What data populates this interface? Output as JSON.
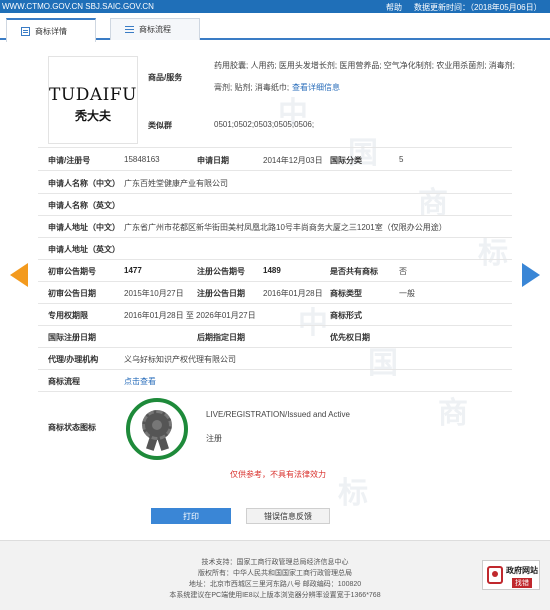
{
  "topbar": {
    "url": "WWW.CTMO.GOV.CN SBJ.SAIC.GOV.CN",
    "help": "帮助",
    "update": "数据更新时间：（2018年05月06日）"
  },
  "tabs": [
    {
      "label": "商标详情"
    },
    {
      "label": "商标流程"
    }
  ],
  "logo": {
    "line1": "TUDAIFU",
    "line2": "秃大夫"
  },
  "watermark_chars": [
    "中",
    "国",
    "商",
    "标"
  ],
  "goods": {
    "label": "商品/服务",
    "line1": "药用胶囊; 人用药; 医用头发增长剂; 医用营养品; 空气净化制剂; 农业用杀菌剂; 消毒剂;",
    "line2": "膏剂; 贴剂; 消毒纸巾;",
    "detail_link": "查看详细信息"
  },
  "similar_group": {
    "label": "类似群",
    "value": "0501;0502;0503;0505;0506;"
  },
  "reg_no": {
    "label": "申请/注册号",
    "value": "15848163"
  },
  "app_date": {
    "label": "申请日期",
    "value": "2014年12月03日"
  },
  "intl_class": {
    "label": "国际分类",
    "value": "5"
  },
  "applicant_cn": {
    "label": "申请人名称（中文）",
    "value": "广东百姓堂健康产业有限公司"
  },
  "applicant_en": {
    "label": "申请人名称（英文）",
    "value": ""
  },
  "address_cn": {
    "label": "申请人地址（中文）",
    "value": "广东省广州市花都区新华街田美村凤凰北路10号丰尚商务大厦之三1201室（仅限办公用途）"
  },
  "address_en": {
    "label": "申请人地址（英文）",
    "value": ""
  },
  "prelim_no": {
    "label": "初审公告期号",
    "value": "1477"
  },
  "reg_pub_no": {
    "label": "注册公告期号",
    "value": "1489"
  },
  "shared": {
    "label": "是否共有商标",
    "value": "否"
  },
  "prelim_date": {
    "label": "初审公告日期",
    "value": "2015年10月27日"
  },
  "reg_pub_date": {
    "label": "注册公告日期",
    "value": "2016年01月28日"
  },
  "tm_type": {
    "label": "商标类型",
    "value": "一般"
  },
  "exclusive": {
    "label": "专用权期限",
    "value": "2016年01月28日 至 2026年01月27日"
  },
  "tm_form": {
    "label": "商标形式",
    "value": ""
  },
  "intl_reg_date": {
    "label": "国际注册日期",
    "value": ""
  },
  "later_date": {
    "label": "后期指定日期",
    "value": ""
  },
  "priority_date": {
    "label": "优先权日期",
    "value": ""
  },
  "agent": {
    "label": "代理/办理机构",
    "value": "义乌好标知识产权代理有限公司"
  },
  "process": {
    "label": "商标流程",
    "link": "点击查看"
  },
  "status": {
    "label": "商标状态图标",
    "text1": "LIVE/REGISTRATION/Issued and Active",
    "text2": "注册"
  },
  "disclaimer": "仅供参考，不具有法律效力",
  "buttons": {
    "print": "打印",
    "feedback": "错误信息反馈"
  },
  "footer": {
    "line1": "技术支持：国家工商行政管理总局经济信息中心",
    "line2": "版权所有：中华人民共和国国家工商行政管理总局",
    "line3": "地址：北京市西城区三里河东路八号   邮政编码：100820",
    "line4": "本系统建议在PC端使用IE8以上版本浏览器分辨率设置宽于1366*768",
    "badge_title": "政府网站",
    "badge_sub": "找错"
  },
  "colors": {
    "topbar": "#1f6fb8",
    "accent": "#3a86d6",
    "nav_prev": "#f39a1e",
    "status_ring": "#1e8a3a",
    "disclaimer": "#d9302c"
  }
}
